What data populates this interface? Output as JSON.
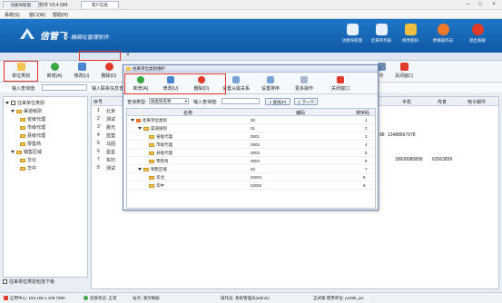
{
  "window": {
    "title": "信管飞进销存软件 V9.4.584"
  },
  "menu": [
    "系统(S)",
    "窗口(W)",
    "帮助(H)"
  ],
  "banner": {
    "brand": "信管飞",
    "slogan": "·精细化管理软件"
  },
  "top_buttons": [
    {
      "label": "功能导航窗",
      "color": "#e6f0ff"
    },
    {
      "label": "近来单列表",
      "color": "#e6f0ff"
    },
    {
      "label": "修改密码",
      "color": "#f0c040"
    },
    {
      "label": "更换操作员",
      "color": "#f07a2a"
    },
    {
      "label": "退出系统",
      "color": "#e03a2a"
    }
  ],
  "tabs": {
    "nav": "功能导航窗",
    "customer": "客户信息",
    "close": "×"
  },
  "toolbar": [
    "单位类别",
    "新增(A)",
    "修改(U)",
    "删除(D)"
  ],
  "toolbar_right": [
    "印",
    "关闭窗口"
  ],
  "search": {
    "label": "输入查询值:",
    "label2": "输入联系信息查询:"
  },
  "left_tree": {
    "root": "往来单位类别",
    "items": [
      {
        "label": "渠道级别",
        "level": 1
      },
      {
        "label": "省级代理",
        "level": 2
      },
      {
        "label": "市级代理",
        "level": 2
      },
      {
        "label": "县级代理",
        "level": 2
      },
      {
        "label": "零售商",
        "level": 2
      },
      {
        "label": "销售区域",
        "level": 1
      },
      {
        "label": "华北",
        "level": 2
      },
      {
        "label": "华中",
        "level": 2
      }
    ],
    "checkbox_label": "往来单位类别包括下级"
  },
  "main_grid": {
    "headers": [
      "序号",
      "手机",
      "传真",
      "电子邮件"
    ],
    "rows": [
      {
        "idx": "1",
        "name": "北京"
      },
      {
        "idx": "2",
        "name": "测试"
      },
      {
        "idx": "3",
        "name": "晨光"
      },
      {
        "idx": "4",
        "name": "蓝塑",
        "mobile": "13488667978",
        "extra": "88"
      },
      {
        "idx": "5",
        "name": "马固"
      },
      {
        "idx": "6",
        "name": "星星"
      },
      {
        "idx": "7",
        "name": "实印",
        "mobile": "18608080808",
        "fax": "63563899"
      },
      {
        "idx": "8",
        "name": "测试"
      }
    ]
  },
  "dialog": {
    "title": "往来单位类别维护",
    "buttons": [
      "新增(A)",
      "修改(U)",
      "删除(D)",
      "设置从属关系",
      "设置排序",
      "更多操作",
      "关闭窗口"
    ],
    "search": {
      "type_label": "查询类型:",
      "type_value": "按类别名称",
      "input_label": "输入查询值:",
      "find_btn": "查找(F)",
      "next_btn": "下一个"
    },
    "headers": {
      "name": "名称",
      "code": "编码",
      "order": "排序码"
    },
    "rows": [
      {
        "name": "往来单位类别",
        "code": "00",
        "order": "1",
        "level": 0
      },
      {
        "name": "渠道级别",
        "code": "01",
        "order": "2",
        "level": 1
      },
      {
        "name": "省级代理",
        "code": "0001",
        "order": "3",
        "level": 2
      },
      {
        "name": "市级代理",
        "code": "0002",
        "order": "4",
        "level": 2
      },
      {
        "name": "县级代理",
        "code": "0003",
        "order": "5",
        "level": 2
      },
      {
        "name": "零售商",
        "code": "0004",
        "order": "6",
        "level": 2
      },
      {
        "name": "销售区域",
        "code": "02",
        "order": "7",
        "level": 1
      },
      {
        "name": "华北",
        "code": "02001",
        "order": "8",
        "level": 2
      },
      {
        "name": "华中",
        "code": "02002",
        "order": "9",
        "level": 2
      }
    ]
  },
  "status": {
    "server": "应用中心: 192.168.1.109:7080",
    "conn": "连接状态: 正常",
    "site": "站点: 演示数据",
    "operator": "操作员: 系统管理员(admin)",
    "license": "正式版 使用单位: pc086_jss"
  }
}
